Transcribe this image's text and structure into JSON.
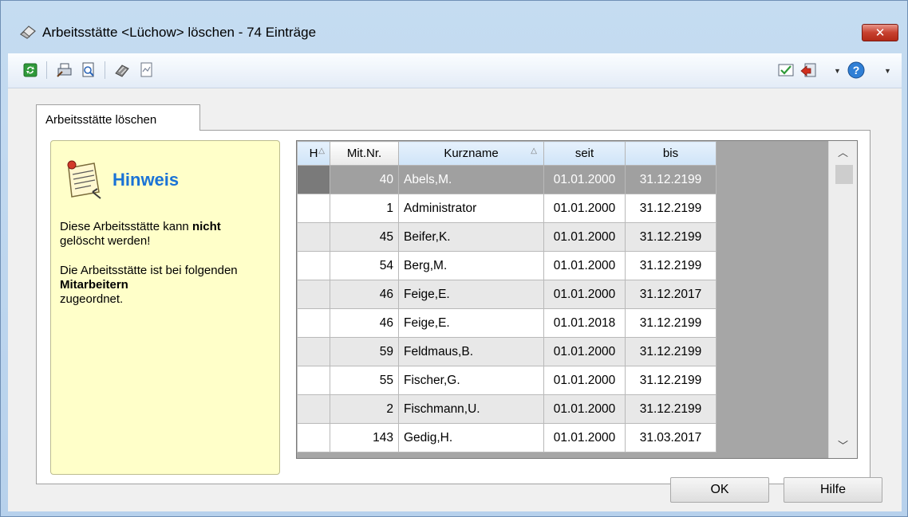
{
  "window": {
    "title": "Arbeitsstätte <Lüchow> löschen - 74 Einträge",
    "close_label": "✕"
  },
  "toolbar": {
    "left_icons": [
      "refresh-icon",
      "print-setup-icon",
      "print-preview-icon",
      "export-icon",
      "report-icon"
    ],
    "right_icons": [
      "checklist-icon",
      "exit-icon",
      "help-icon"
    ]
  },
  "tab": {
    "label": "Arbeitsstätte löschen"
  },
  "note": {
    "title": "Hinweis",
    "line1_pre": "Diese Arbeitsstätte kann ",
    "line1_bold": "nicht",
    "line1_post": "gelöscht werden!",
    "line2_pre": "Die Arbeitsstätte ist bei folgenden ",
    "line2_bold": "Mitarbeitern",
    "line2_post": "zugeordnet."
  },
  "table": {
    "headers": {
      "h": "H",
      "nr": "Mit.Nr.",
      "name": "Kurzname",
      "seit": "seit",
      "bis": "bis"
    },
    "rows": [
      {
        "nr": "40",
        "name": "Abels,M.",
        "seit": "01.01.2000",
        "bis": "31.12.2199"
      },
      {
        "nr": "1",
        "name": "Administrator",
        "seit": "01.01.2000",
        "bis": "31.12.2199"
      },
      {
        "nr": "45",
        "name": "Beifer,K.",
        "seit": "01.01.2000",
        "bis": "31.12.2199"
      },
      {
        "nr": "54",
        "name": "Berg,M.",
        "seit": "01.01.2000",
        "bis": "31.12.2199"
      },
      {
        "nr": "46",
        "name": "Feige,E.",
        "seit": "01.01.2000",
        "bis": "31.12.2017"
      },
      {
        "nr": "46",
        "name": "Feige,E.",
        "seit": "01.01.2018",
        "bis": "31.12.2199"
      },
      {
        "nr": "59",
        "name": "Feldmaus,B.",
        "seit": "01.01.2000",
        "bis": "31.12.2199"
      },
      {
        "nr": "55",
        "name": "Fischer,G.",
        "seit": "01.01.2000",
        "bis": "31.12.2199"
      },
      {
        "nr": "2",
        "name": "Fischmann,U.",
        "seit": "01.01.2000",
        "bis": "31.12.2199"
      },
      {
        "nr": "143",
        "name": "Gedig,H.",
        "seit": "01.01.2000",
        "bis": "31.03.2017"
      }
    ]
  },
  "buttons": {
    "ok": "OK",
    "help": "Hilfe"
  },
  "colors": {
    "accent": "#1a73d6",
    "note_bg": "#ffffc9",
    "close_red": "#c7412f"
  }
}
